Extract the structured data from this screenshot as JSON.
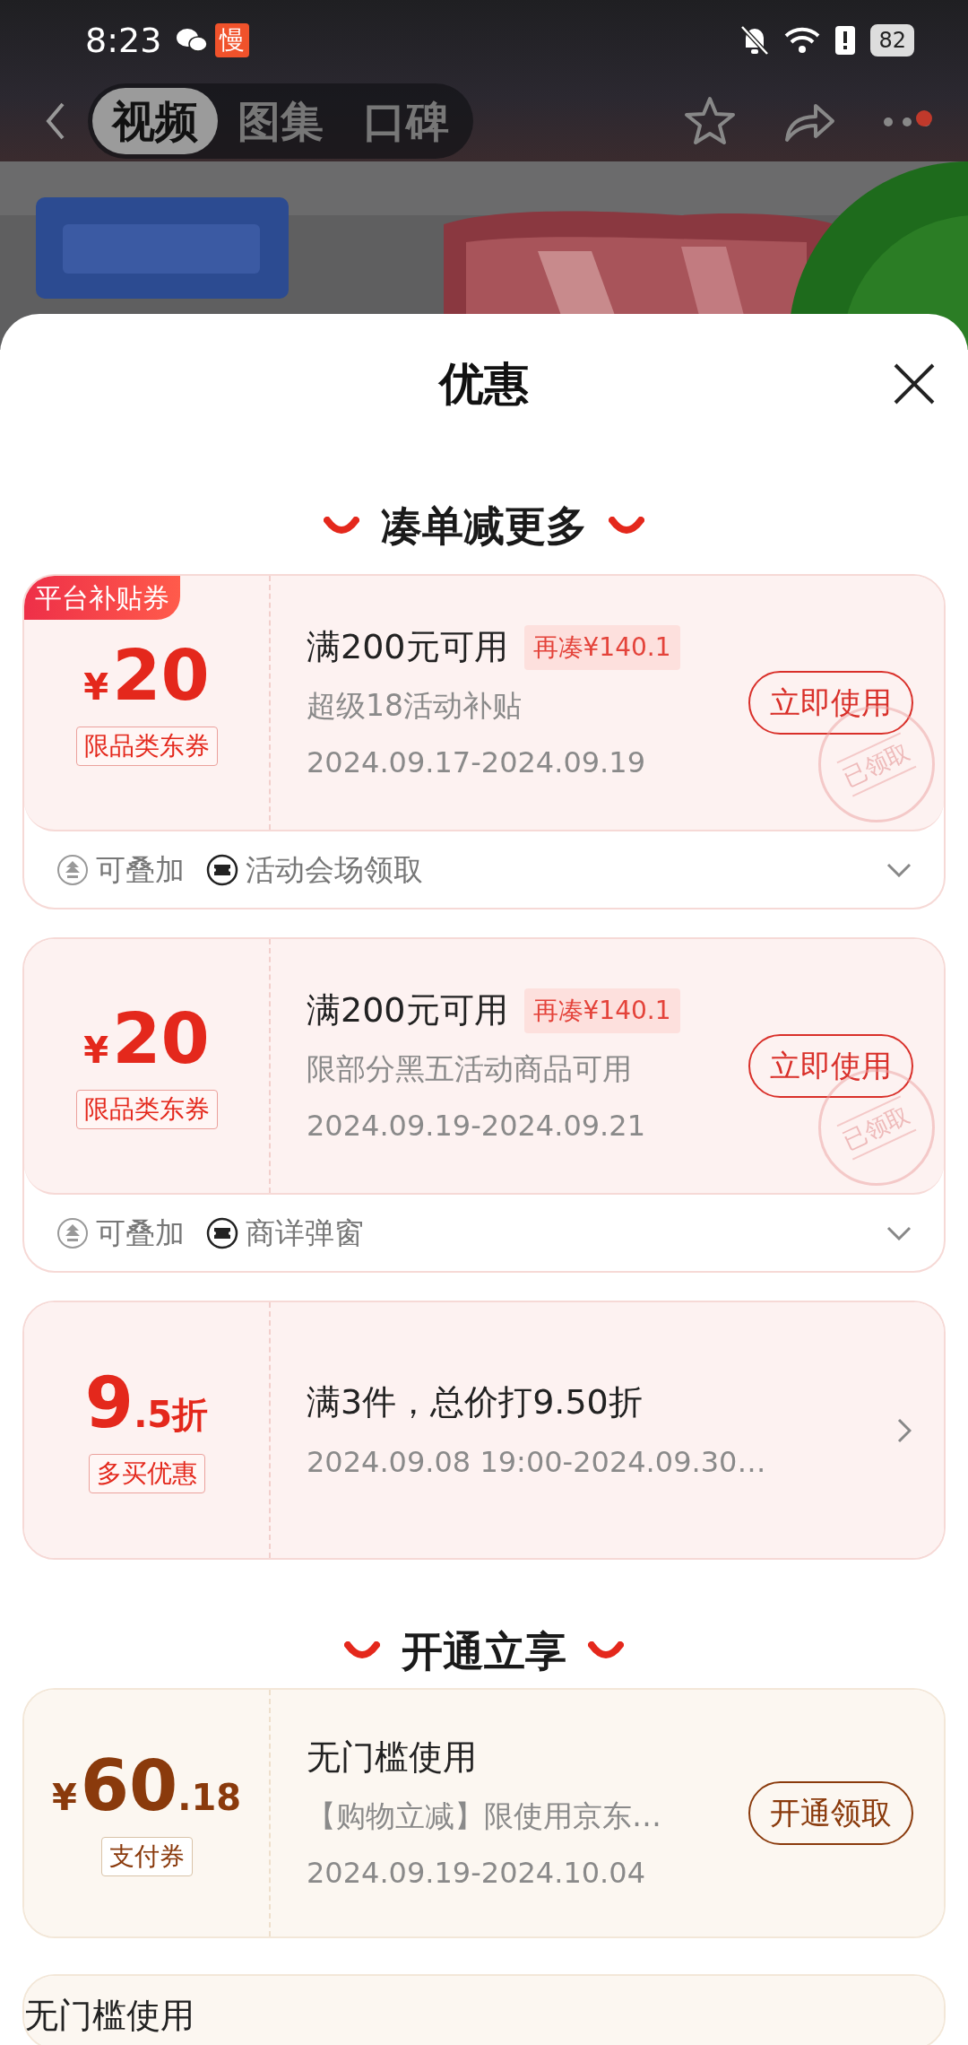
{
  "status_bar": {
    "time": "8:23",
    "app_badge": "慢",
    "battery": "82"
  },
  "nav": {
    "tabs": [
      {
        "label": "视频",
        "selected": true
      },
      {
        "label": "图集",
        "selected": false
      },
      {
        "label": "口碑",
        "selected": false
      }
    ],
    "more_unread": true
  },
  "sheet": {
    "title": "优惠",
    "sections": [
      {
        "title": "凑单减更多",
        "kind": "promo",
        "coupons": [
          {
            "kind": "amount",
            "tag": "平台补贴券",
            "currency": "¥",
            "amount": "20",
            "badge": "限品类东券",
            "title": "满200元可用",
            "gap_tag": "再凑¥140.1",
            "subtitle": "超级18活动补贴",
            "period": "2024.09.17-2024.09.19",
            "action": "立即使用",
            "stamp": "已领取",
            "footer": {
              "stackable": "可叠加",
              "source": "活动会场领取",
              "expanded": false
            }
          },
          {
            "kind": "amount",
            "currency": "¥",
            "amount": "20",
            "badge": "限品类东券",
            "title": "满200元可用",
            "gap_tag": "再凑¥140.1",
            "subtitle": "限部分黑五活动商品可用",
            "period": "2024.09.19-2024.09.21",
            "action": "立即使用",
            "stamp": "已领取",
            "footer": {
              "stackable": "可叠加",
              "source": "商详弹窗",
              "expanded": false
            }
          },
          {
            "kind": "discount",
            "amount": "9",
            "amount_suffix": ".5折",
            "badge": "多买优惠",
            "title": "满3件，总价打9.50折",
            "period": "2024.09.08 19:00-2024.09.30…"
          }
        ]
      },
      {
        "title": "开通立享",
        "kind": "membership",
        "coupons": [
          {
            "kind": "amount",
            "currency": "¥",
            "amount": "60",
            "amount_suffix": ".18",
            "badge": "支付券",
            "title": "无门槛使用",
            "subtitle": "【购物立减】限使用京东…",
            "period": "2024.09.19-2024.10.04",
            "action": "开通领取"
          },
          {
            "kind": "partial",
            "title": "无门槛使用"
          }
        ]
      }
    ]
  }
}
